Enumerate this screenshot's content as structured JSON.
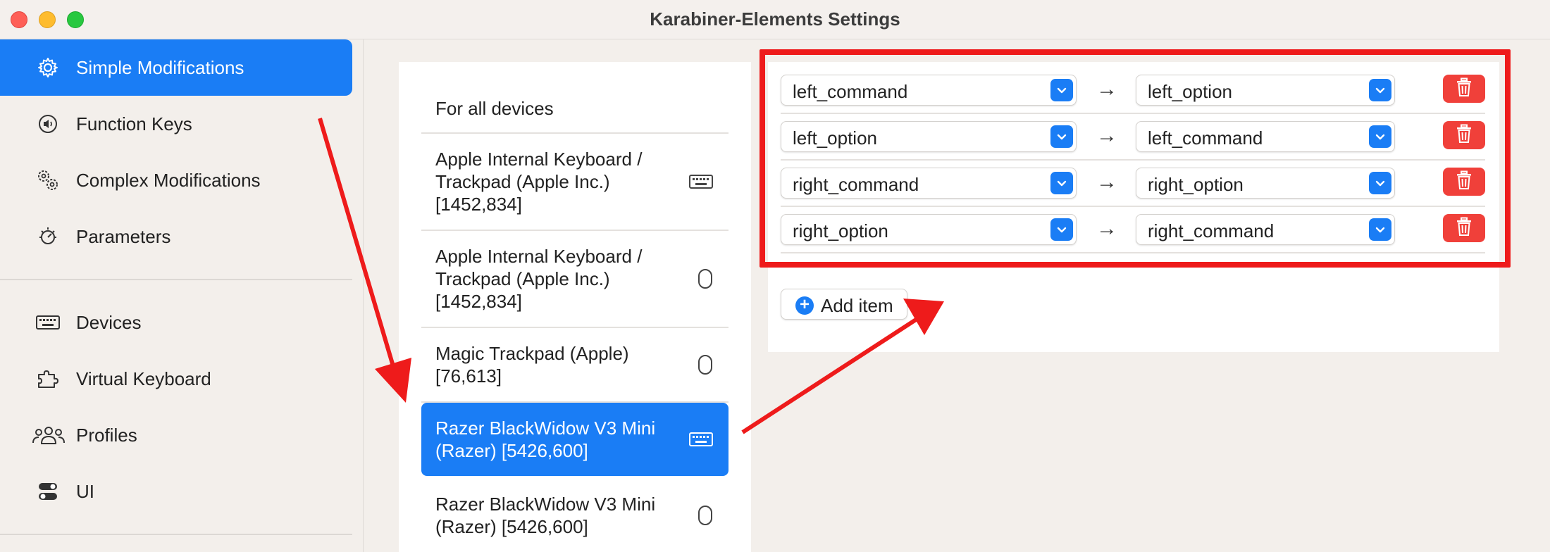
{
  "window": {
    "title": "Karabiner-Elements Settings"
  },
  "sidebar": {
    "items": [
      {
        "label": "Simple Modifications",
        "icon": "gear-icon",
        "active": true
      },
      {
        "label": "Function Keys",
        "icon": "speaker-icon",
        "active": false
      },
      {
        "label": "Complex Modifications",
        "icon": "gears-icon",
        "active": false
      },
      {
        "label": "Parameters",
        "icon": "dial-icon",
        "active": false
      },
      {
        "label": "Devices",
        "icon": "keyboard-icon",
        "active": false
      },
      {
        "label": "Virtual Keyboard",
        "icon": "puzzle-icon",
        "active": false
      },
      {
        "label": "Profiles",
        "icon": "people-icon",
        "active": false
      },
      {
        "label": "UI",
        "icon": "toggles-icon",
        "active": false
      }
    ]
  },
  "devices": [
    {
      "label": "For all devices",
      "icon": "none"
    },
    {
      "label": "Apple Internal Keyboard / Trackpad (Apple Inc.) [1452,834]",
      "icon": "keyboard-icon"
    },
    {
      "label": "Apple Internal Keyboard / Trackpad (Apple Inc.) [1452,834]",
      "icon": "mouse-icon"
    },
    {
      "label": "Magic Trackpad (Apple) [76,613]",
      "icon": "mouse-icon"
    },
    {
      "label": "Razer BlackWidow V3 Mini (Razer) [5426,600]",
      "icon": "keyboard-icon",
      "selected": true
    },
    {
      "label": "Razer BlackWidow V3 Mini (Razer) [5426,600]",
      "icon": "mouse-icon"
    }
  ],
  "modifications": [
    {
      "from": "left_command",
      "to": "left_option"
    },
    {
      "from": "left_option",
      "to": "left_command"
    },
    {
      "from": "right_command",
      "to": "right_option"
    },
    {
      "from": "right_option",
      "to": "right_command"
    }
  ],
  "arrow_symbol": "→",
  "add_item": {
    "label": "Add item",
    "symbol": "+"
  },
  "colors": {
    "accent": "#1a7df5",
    "delete": "#f0403a",
    "annotation": "#ee1b1b"
  }
}
